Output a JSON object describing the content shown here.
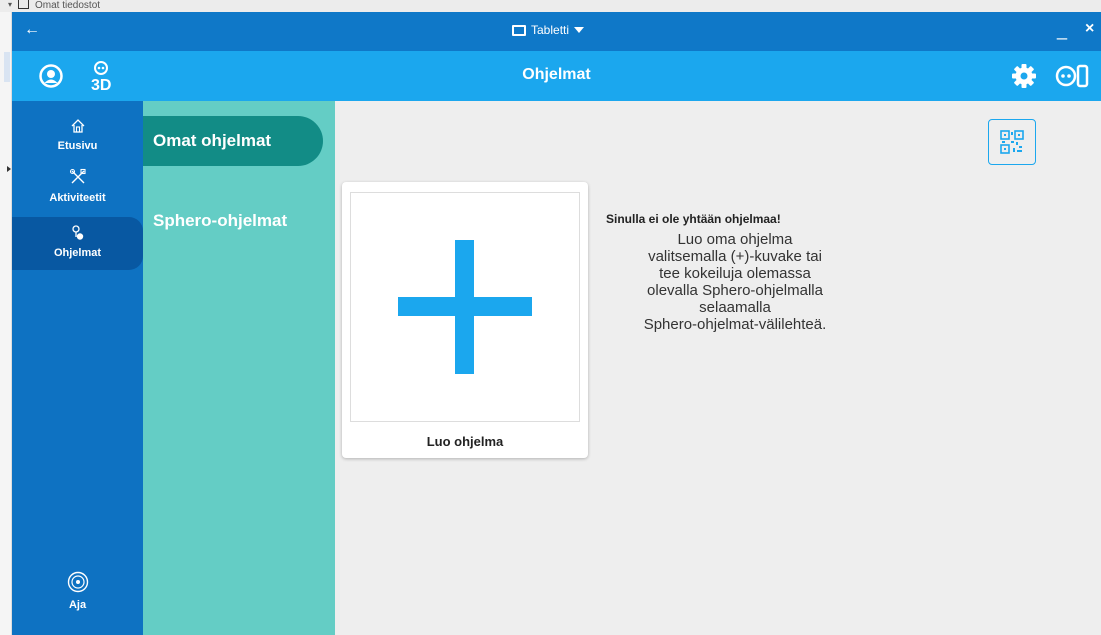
{
  "background": {
    "window_label": "Omat tiedostot"
  },
  "titlebar": {
    "back_icon": "←",
    "device_label": "Tabletti",
    "minimize": "_",
    "close": "×"
  },
  "header": {
    "title": "Ohjelmat"
  },
  "nav": {
    "items": [
      {
        "label": "Etusivu",
        "icon": "home-icon"
      },
      {
        "label": "Aktiviteetit",
        "icon": "tools-icon"
      },
      {
        "label": "Ohjelmat",
        "icon": "programs-icon",
        "active": true
      }
    ],
    "drive": {
      "label": "Aja",
      "icon": "steering-wheel-icon"
    }
  },
  "subnav": {
    "tabs": [
      {
        "label": "Omat ohjelmat",
        "active": true
      },
      {
        "label": "Sphero-ohjelmat"
      }
    ]
  },
  "content": {
    "create_card_label": "Luo ohjelma",
    "empty_title": "Sinulla ei ole yhtään ohjelmaa!",
    "empty_body": "Luo oma ohjelma\nvalitsemalla (+)-kuvake tai\ntee kokeiluja olemassa\nolevalla Sphero-ohjelmalla\nselaamalla\nSphero-ohjelmat-välilehteä."
  },
  "colors": {
    "titlebar": "#0f78c8",
    "header": "#1ba7ee",
    "nav": "#0e72c2",
    "subnav": "#64cdc5",
    "subnav_active": "#128c86",
    "plus": "#1ba7ee"
  }
}
